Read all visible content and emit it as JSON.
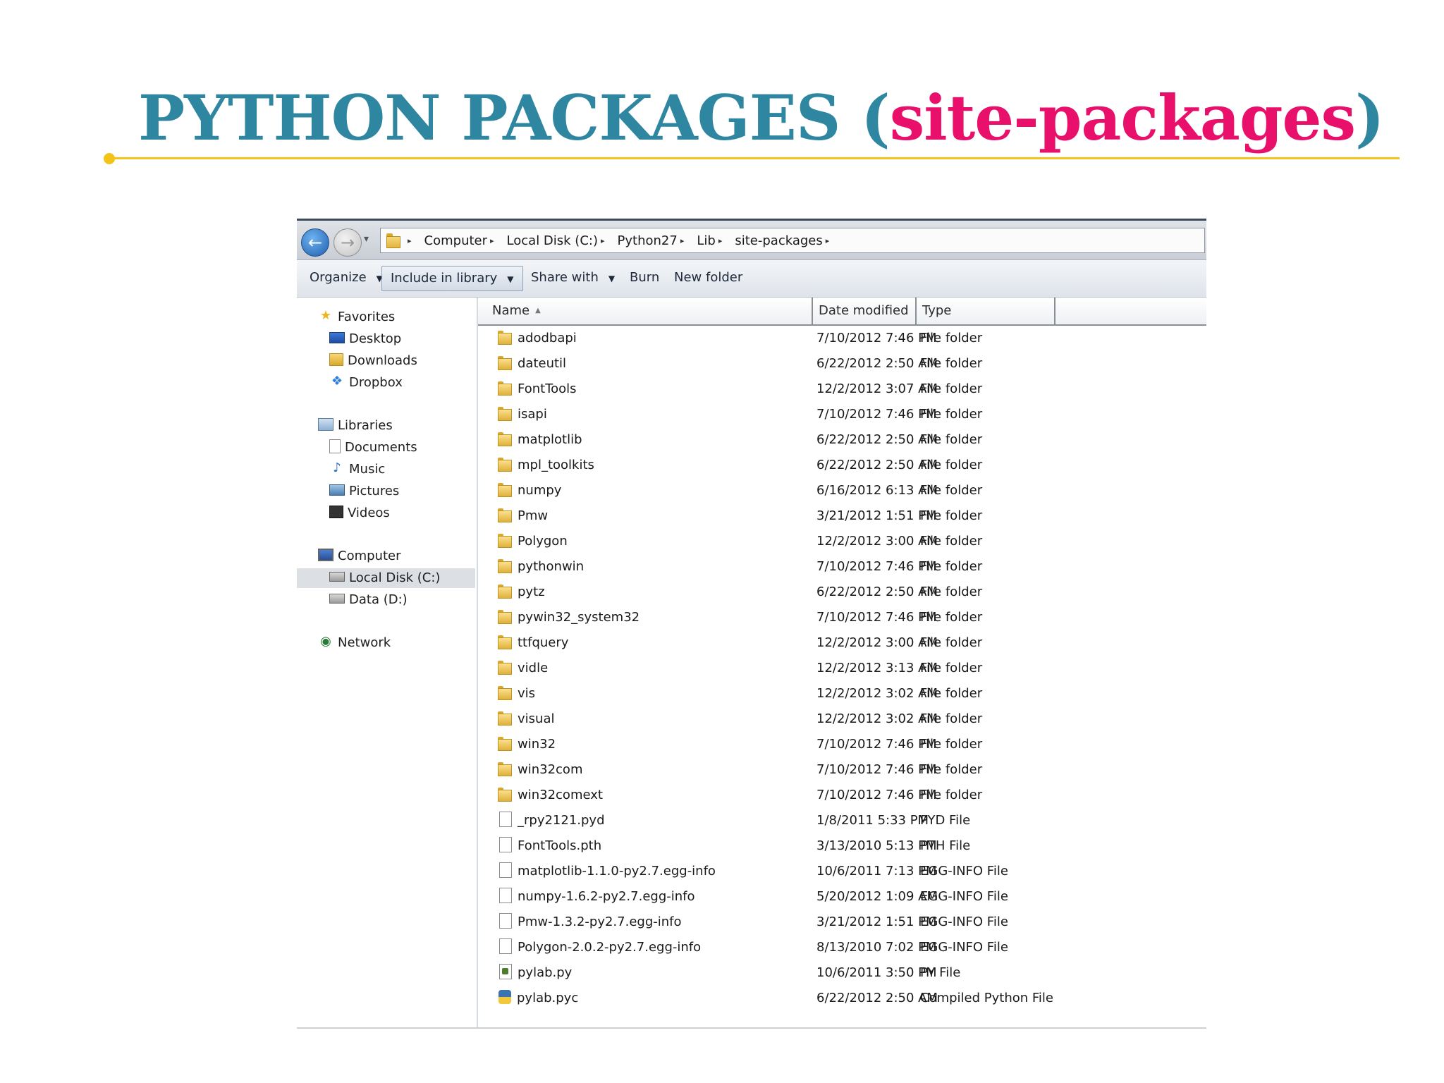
{
  "slide": {
    "title_main": "PYTHON PACKAGES (",
    "title_accent": "site-packages",
    "title_close": ")"
  },
  "address": {
    "crumbs": [
      "Computer",
      "Local Disk (C:)",
      "Python27",
      "Lib",
      "site-packages"
    ]
  },
  "toolbar": {
    "organize": "Organize",
    "include_in_library": "Include in library",
    "share_with": "Share with",
    "burn": "Burn",
    "new_folder": "New folder"
  },
  "nav": {
    "favorites": "Favorites",
    "desktop": "Desktop",
    "downloads": "Downloads",
    "dropbox": "Dropbox",
    "libraries": "Libraries",
    "documents": "Documents",
    "music": "Music",
    "pictures": "Pictures",
    "videos": "Videos",
    "computer": "Computer",
    "local_disk": "Local Disk (C:)",
    "data_disk": "Data (D:)",
    "network": "Network"
  },
  "columns": {
    "name": "Name",
    "date": "Date modified",
    "type": "Type"
  },
  "files": [
    {
      "name": "adodbapi",
      "date": "7/10/2012 7:46 PM",
      "type": "File folder",
      "icon": "folder"
    },
    {
      "name": "dateutil",
      "date": "6/22/2012 2:50 AM",
      "type": "File folder",
      "icon": "folder"
    },
    {
      "name": "FontTools",
      "date": "12/2/2012 3:07 AM",
      "type": "File folder",
      "icon": "folder"
    },
    {
      "name": "isapi",
      "date": "7/10/2012 7:46 PM",
      "type": "File folder",
      "icon": "folder"
    },
    {
      "name": "matplotlib",
      "date": "6/22/2012 2:50 AM",
      "type": "File folder",
      "icon": "folder"
    },
    {
      "name": "mpl_toolkits",
      "date": "6/22/2012 2:50 AM",
      "type": "File folder",
      "icon": "folder"
    },
    {
      "name": "numpy",
      "date": "6/16/2012 6:13 AM",
      "type": "File folder",
      "icon": "folder"
    },
    {
      "name": "Pmw",
      "date": "3/21/2012 1:51 PM",
      "type": "File folder",
      "icon": "folder"
    },
    {
      "name": "Polygon",
      "date": "12/2/2012 3:00 AM",
      "type": "File folder",
      "icon": "folder"
    },
    {
      "name": "pythonwin",
      "date": "7/10/2012 7:46 PM",
      "type": "File folder",
      "icon": "folder"
    },
    {
      "name": "pytz",
      "date": "6/22/2012 2:50 AM",
      "type": "File folder",
      "icon": "folder"
    },
    {
      "name": "pywin32_system32",
      "date": "7/10/2012 7:46 PM",
      "type": "File folder",
      "icon": "folder"
    },
    {
      "name": "ttfquery",
      "date": "12/2/2012 3:00 AM",
      "type": "File folder",
      "icon": "folder"
    },
    {
      "name": "vidle",
      "date": "12/2/2012 3:13 AM",
      "type": "File folder",
      "icon": "folder"
    },
    {
      "name": "vis",
      "date": "12/2/2012 3:02 AM",
      "type": "File folder",
      "icon": "folder"
    },
    {
      "name": "visual",
      "date": "12/2/2012 3:02 AM",
      "type": "File folder",
      "icon": "folder"
    },
    {
      "name": "win32",
      "date": "7/10/2012 7:46 PM",
      "type": "File folder",
      "icon": "folder"
    },
    {
      "name": "win32com",
      "date": "7/10/2012 7:46 PM",
      "type": "File folder",
      "icon": "folder"
    },
    {
      "name": "win32comext",
      "date": "7/10/2012 7:46 PM",
      "type": "File folder",
      "icon": "folder"
    },
    {
      "name": "_rpy2121.pyd",
      "date": "1/8/2011 5:33 PM",
      "type": "PYD File",
      "icon": "file"
    },
    {
      "name": "FontTools.pth",
      "date": "3/13/2010 5:13 PM",
      "type": "PTH File",
      "icon": "file"
    },
    {
      "name": "matplotlib-1.1.0-py2.7.egg-info",
      "date": "10/6/2011 7:13 PM",
      "type": "EGG-INFO File",
      "icon": "file"
    },
    {
      "name": "numpy-1.6.2-py2.7.egg-info",
      "date": "5/20/2012 1:09 AM",
      "type": "EGG-INFO File",
      "icon": "file"
    },
    {
      "name": "Pmw-1.3.2-py2.7.egg-info",
      "date": "3/21/2012 1:51 PM",
      "type": "EGG-INFO File",
      "icon": "file"
    },
    {
      "name": "Polygon-2.0.2-py2.7.egg-info",
      "date": "8/13/2010 7:02 PM",
      "type": "EGG-INFO File",
      "icon": "file"
    },
    {
      "name": "pylab.py",
      "date": "10/6/2011 3:50 PM",
      "type": "PY File",
      "icon": "py"
    },
    {
      "name": "pylab.pyc",
      "date": "6/22/2012 2:50 AM",
      "type": "Compiled Python File",
      "icon": "pyc"
    }
  ],
  "colors": {
    "title_main": "#2E86A0",
    "title_accent": "#E8106A",
    "rule": "#F3C318"
  }
}
